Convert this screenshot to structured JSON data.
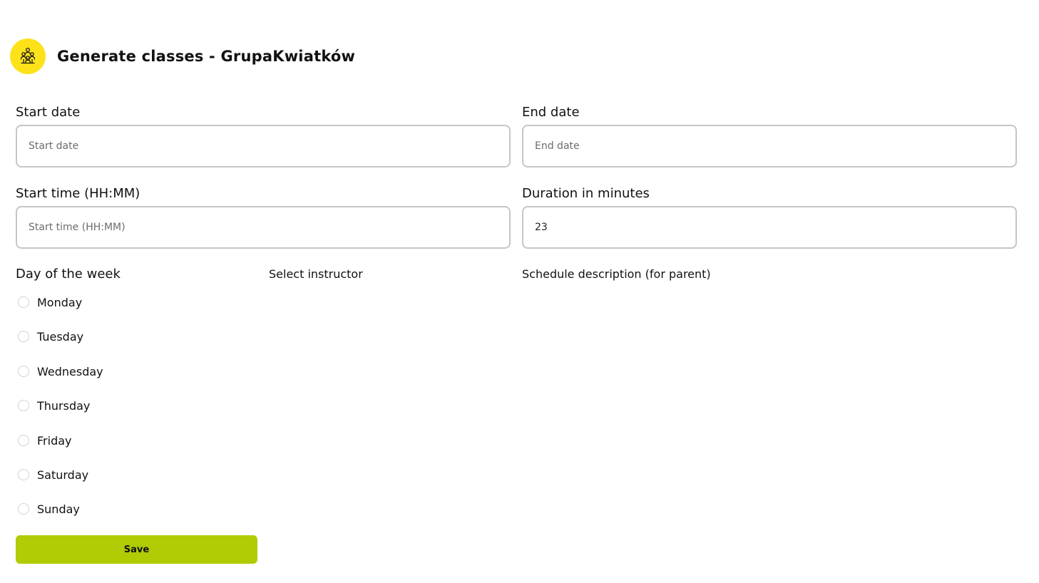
{
  "header": {
    "title": "Generate classes - GrupaKwiatków",
    "logo_icon": "group-people-icon"
  },
  "colors": {
    "accent_yellow": "#fde21a",
    "save_green": "#b1cb05"
  },
  "form": {
    "start_date": {
      "label": "Start date",
      "placeholder": "Start date",
      "value": ""
    },
    "end_date": {
      "label": "End date",
      "placeholder": "End date",
      "value": ""
    },
    "start_time": {
      "label": "Start time (HH:MM)",
      "placeholder": "Start time (HH:MM)",
      "value": ""
    },
    "duration": {
      "label": "Duration in minutes",
      "placeholder": "",
      "value": "23"
    },
    "day_of_week": {
      "label": "Day of the week",
      "options": [
        "Monday",
        "Tuesday",
        "Wednesday",
        "Thursday",
        "Friday",
        "Saturday",
        "Sunday"
      ]
    },
    "instructor": {
      "label": "Select instructor"
    },
    "schedule_description": {
      "label": "Schedule description (for parent)"
    },
    "save_label": "Save"
  }
}
